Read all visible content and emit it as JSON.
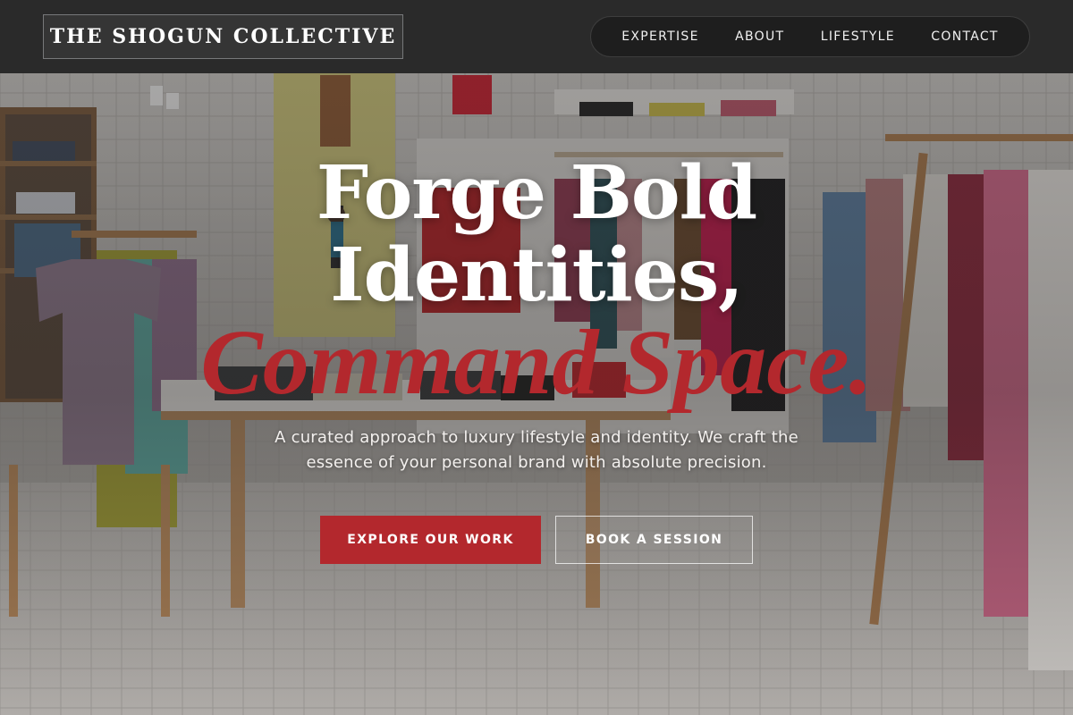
{
  "brand": {
    "name": "THE SHOGUN COLLECTIVE"
  },
  "nav": {
    "items": [
      {
        "label": "EXPERTISE"
      },
      {
        "label": "ABOUT"
      },
      {
        "label": "LIFESTYLE"
      },
      {
        "label": "CONTACT"
      }
    ]
  },
  "hero": {
    "headline_line1": "Forge Bold",
    "headline_line2": "Identities,",
    "headline_accent": "Command Space.",
    "subtext": "A curated approach to luxury lifestyle and identity. We craft the essence of your personal brand with absolute precision.",
    "background_image": "clothing-store-interior-photo",
    "primary_cta": "EXPLORE OUR WORK",
    "secondary_cta": "BOOK A SESSION"
  },
  "colors": {
    "accent": "#b3282d",
    "header_bg": "#2a2a2a",
    "nav_pill_bg": "#1e1e1e",
    "text_light": "#ffffff"
  }
}
